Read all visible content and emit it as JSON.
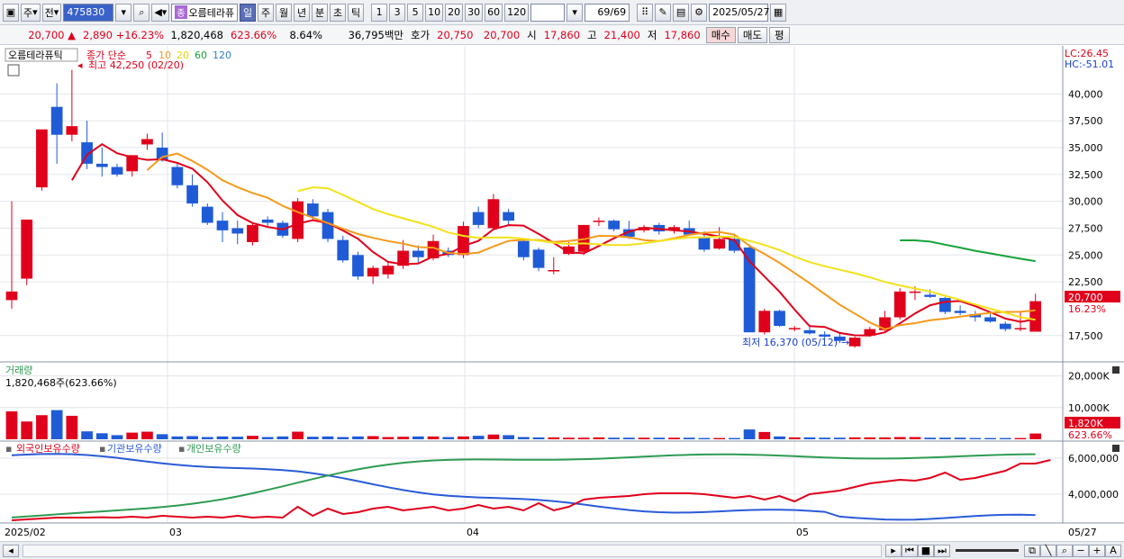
{
  "toolbar": {
    "period_left": "주",
    "prev_label": "전",
    "code": "475830",
    "name_badge": "종",
    "name": "오름테라퓨",
    "periods": [
      "일",
      "주",
      "월",
      "년",
      "분",
      "초",
      "틱"
    ],
    "active_period_index": 0,
    "numbers": [
      "1",
      "3",
      "5",
      "10",
      "20",
      "30",
      "60",
      "120"
    ],
    "count": "69/69",
    "date": "2025/05/27"
  },
  "quote": {
    "price": "20,700",
    "change": "2,890",
    "change_pct": "+16.23%",
    "volume": "1,820,468",
    "vol_ratio": "623.66%",
    "turnover": "8.64%",
    "amount": "36,795백만",
    "bid_label": "호가",
    "ask": "20,750",
    "bid": "20,700",
    "open_label": "시",
    "open": "17,860",
    "high_label": "고",
    "high": "21,400",
    "low_label": "저",
    "low": "17,860",
    "buy_label": "매수",
    "sell_label": "매도",
    "eval_label": "평"
  },
  "price_panel": {
    "title": "오름테라퓨틱",
    "ma_label": "종가 단순",
    "ma_periods": [
      "5",
      "10",
      "20",
      "60",
      "120"
    ],
    "ma_colors": [
      "#e0001b",
      "#f59a1c",
      "#f2e21a",
      "#16a23a",
      "#2f7fc8"
    ],
    "lc": "LC:26.45",
    "hc": "HC:-51.01",
    "high_annot": "최고 42,250 (02/20)",
    "low_annot": "최저 16,370 (05/12)",
    "last_price": "20,700",
    "last_pct": "16.23%",
    "y_ticks": [
      "40,000",
      "37,500",
      "35,000",
      "32,500",
      "30,000",
      "27,500",
      "25,000",
      "22,500",
      "17,500"
    ]
  },
  "volume_panel": {
    "title": "거래량",
    "info": "1,820,468주(623.66%)",
    "y_ticks": [
      "20,000K",
      "10,000K"
    ],
    "last": "1,820K",
    "last_pct": "623.66%"
  },
  "holding_panel": {
    "legend": [
      "외국인보유수량",
      "기관보유수량",
      "개인보유수량"
    ],
    "colors": [
      "#e0001b",
      "#2a5bd7",
      "#2e9b52"
    ],
    "y_ticks": [
      "6,000,000",
      "4,000,000"
    ]
  },
  "x_labels": [
    "2025/02",
    "03",
    "04",
    "05",
    "05/27"
  ],
  "chart_data": {
    "type": "candlestick",
    "candles": [
      {
        "o": 20800,
        "h": 30000,
        "l": 20000,
        "c": 21600
      },
      {
        "o": 22800,
        "h": 28300,
        "l": 22200,
        "c": 28300
      },
      {
        "o": 31300,
        "h": 36700,
        "l": 31000,
        "c": 36700
      },
      {
        "o": 38800,
        "h": 41000,
        "l": 33500,
        "c": 36200
      },
      {
        "o": 36200,
        "h": 42250,
        "l": 35600,
        "c": 37000
      },
      {
        "o": 35500,
        "h": 37500,
        "l": 33000,
        "c": 33500
      },
      {
        "o": 33500,
        "h": 35000,
        "l": 32300,
        "c": 33200
      },
      {
        "o": 33200,
        "h": 33500,
        "l": 32300,
        "c": 32500
      },
      {
        "o": 32800,
        "h": 34300,
        "l": 32300,
        "c": 34300
      },
      {
        "o": 35300,
        "h": 36300,
        "l": 34800,
        "c": 35800
      },
      {
        "o": 35000,
        "h": 36400,
        "l": 33700,
        "c": 33800
      },
      {
        "o": 33200,
        "h": 33600,
        "l": 31200,
        "c": 31500
      },
      {
        "o": 31500,
        "h": 32500,
        "l": 29500,
        "c": 29800
      },
      {
        "o": 29500,
        "h": 29800,
        "l": 27800,
        "c": 28000
      },
      {
        "o": 28200,
        "h": 29000,
        "l": 26200,
        "c": 27300
      },
      {
        "o": 27500,
        "h": 28200,
        "l": 26000,
        "c": 27000
      },
      {
        "o": 26200,
        "h": 28000,
        "l": 25900,
        "c": 27800
      },
      {
        "o": 28300,
        "h": 28600,
        "l": 27700,
        "c": 28000
      },
      {
        "o": 28000,
        "h": 28200,
        "l": 26600,
        "c": 26800
      },
      {
        "o": 26500,
        "h": 30300,
        "l": 26200,
        "c": 30000
      },
      {
        "o": 29800,
        "h": 30200,
        "l": 28300,
        "c": 28600
      },
      {
        "o": 29000,
        "h": 29300,
        "l": 26200,
        "c": 26500
      },
      {
        "o": 26400,
        "h": 26800,
        "l": 24300,
        "c": 24500
      },
      {
        "o": 25000,
        "h": 25300,
        "l": 22700,
        "c": 23000
      },
      {
        "o": 23000,
        "h": 24000,
        "l": 22300,
        "c": 23800
      },
      {
        "o": 23200,
        "h": 24400,
        "l": 22800,
        "c": 24000
      },
      {
        "o": 24000,
        "h": 26400,
        "l": 23700,
        "c": 25400
      },
      {
        "o": 25400,
        "h": 25900,
        "l": 24300,
        "c": 24800
      },
      {
        "o": 24700,
        "h": 26900,
        "l": 24500,
        "c": 26300
      },
      {
        "o": 25400,
        "h": 25700,
        "l": 24800,
        "c": 25000
      },
      {
        "o": 25000,
        "h": 28100,
        "l": 24700,
        "c": 27700
      },
      {
        "o": 29000,
        "h": 29500,
        "l": 27500,
        "c": 27800
      },
      {
        "o": 27500,
        "h": 30700,
        "l": 27300,
        "c": 30200
      },
      {
        "o": 29000,
        "h": 29300,
        "l": 27800,
        "c": 28200
      },
      {
        "o": 26300,
        "h": 26500,
        "l": 24500,
        "c": 24800
      },
      {
        "o": 25500,
        "h": 25700,
        "l": 23500,
        "c": 23800
      },
      {
        "o": 23500,
        "h": 24800,
        "l": 23200,
        "c": 23600
      },
      {
        "o": 25100,
        "h": 26200,
        "l": 25000,
        "c": 25800
      },
      {
        "o": 25300,
        "h": 27800,
        "l": 25000,
        "c": 27800
      },
      {
        "o": 28100,
        "h": 28500,
        "l": 27700,
        "c": 28200
      },
      {
        "o": 28200,
        "h": 28300,
        "l": 27200,
        "c": 27400
      },
      {
        "o": 27400,
        "h": 28200,
        "l": 26500,
        "c": 26700
      },
      {
        "o": 27300,
        "h": 27800,
        "l": 27100,
        "c": 27600
      },
      {
        "o": 27800,
        "h": 28000,
        "l": 26900,
        "c": 27200
      },
      {
        "o": 27300,
        "h": 27800,
        "l": 27000,
        "c": 27600
      },
      {
        "o": 27500,
        "h": 28200,
        "l": 26800,
        "c": 26900
      },
      {
        "o": 26700,
        "h": 27200,
        "l": 25300,
        "c": 25500
      },
      {
        "o": 25600,
        "h": 27600,
        "l": 25500,
        "c": 26500
      },
      {
        "o": 26500,
        "h": 27000,
        "l": 25200,
        "c": 25400
      },
      {
        "o": 25700,
        "h": 26000,
        "l": 17800,
        "c": 17800
      },
      {
        "o": 17800,
        "h": 20000,
        "l": 17600,
        "c": 19800
      },
      {
        "o": 19800,
        "h": 19900,
        "l": 18300,
        "c": 18400
      },
      {
        "o": 18200,
        "h": 18400,
        "l": 17900,
        "c": 18200
      },
      {
        "o": 18000,
        "h": 18300,
        "l": 17600,
        "c": 17700
      },
      {
        "o": 17600,
        "h": 17900,
        "l": 17200,
        "c": 17400
      },
      {
        "o": 17400,
        "h": 17700,
        "l": 16800,
        "c": 17000
      },
      {
        "o": 16500,
        "h": 17400,
        "l": 16370,
        "c": 17300
      },
      {
        "o": 17500,
        "h": 18300,
        "l": 17400,
        "c": 18100
      },
      {
        "o": 18000,
        "h": 19800,
        "l": 17900,
        "c": 19200
      },
      {
        "o": 19200,
        "h": 21900,
        "l": 19000,
        "c": 21600
      },
      {
        "o": 21500,
        "h": 22100,
        "l": 20800,
        "c": 21600
      },
      {
        "o": 21300,
        "h": 21800,
        "l": 21000,
        "c": 21100
      },
      {
        "o": 21000,
        "h": 21100,
        "l": 19500,
        "c": 19700
      },
      {
        "o": 19800,
        "h": 20300,
        "l": 19400,
        "c": 19600
      },
      {
        "o": 19500,
        "h": 19800,
        "l": 18800,
        "c": 19200
      },
      {
        "o": 19200,
        "h": 19600,
        "l": 18700,
        "c": 18800
      },
      {
        "o": 18600,
        "h": 18800,
        "l": 17900,
        "c": 18100
      },
      {
        "o": 18100,
        "h": 19800,
        "l": 17900,
        "c": 18200
      },
      {
        "o": 17860,
        "h": 21400,
        "l": 17860,
        "c": 20700
      }
    ],
    "volume": [
      8800,
      5600,
      7600,
      9200,
      7400,
      2500,
      1900,
      1300,
      2100,
      2400,
      1600,
      900,
      1000,
      700,
      900,
      800,
      1100,
      700,
      900,
      2400,
      800,
      900,
      700,
      900,
      1000,
      700,
      800,
      900,
      900,
      700,
      900,
      1100,
      1500,
      1300,
      700,
      600,
      600,
      500,
      500,
      600,
      500,
      500,
      500,
      500,
      500,
      500,
      400,
      400,
      400,
      3100,
      2300,
      900,
      600,
      600,
      500,
      500,
      600,
      600,
      600,
      700,
      700,
      500,
      500,
      500,
      400,
      400,
      400,
      400,
      1820
    ],
    "foreign": [
      2550000,
      2600000,
      2650000,
      2700000,
      2700000,
      2700000,
      2720000,
      2700000,
      2750000,
      2700000,
      2800000,
      2750000,
      2700000,
      2750000,
      2700000,
      2800000,
      2700000,
      2750000,
      2700000,
      3300000,
      2800000,
      3200000,
      2900000,
      3000000,
      3200000,
      3300000,
      3100000,
      3200000,
      3300000,
      3100000,
      3200000,
      3400000,
      3200000,
      3300000,
      3100000,
      3500000,
      3100000,
      3300000,
      3700000,
      3800000,
      3850000,
      3900000,
      4000000,
      4050000,
      4050000,
      4050000,
      4000000,
      3900000,
      3800000,
      3900000,
      3700000,
      3900000,
      3600000,
      4000000,
      4100000,
      4200000,
      4400000,
      4600000,
      4700000,
      4800000,
      4750000,
      4900000,
      5200000,
      4800000,
      4900000,
      5100000,
      5300000,
      5700000,
      5700000,
      5900000
    ]
  }
}
